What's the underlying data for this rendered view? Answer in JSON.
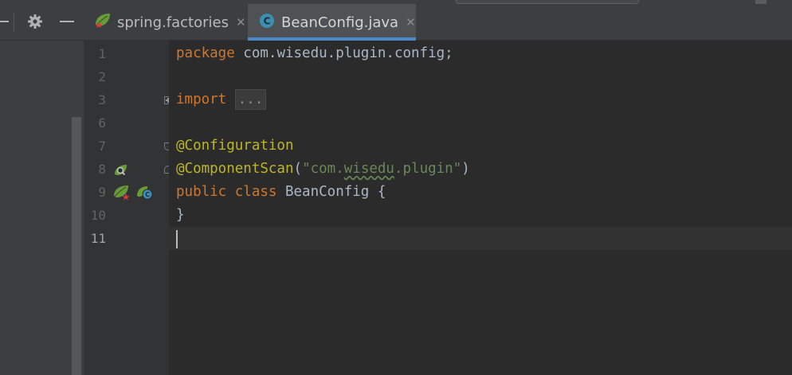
{
  "tabs": [
    {
      "label": "spring.factories",
      "active": false,
      "icon": "spring-leaf-icon"
    },
    {
      "label": "BeanConfig.java",
      "active": true,
      "icon": "java-class-icon"
    }
  ],
  "toolbar": {
    "settings_icon": "gear-icon",
    "hide_icon": "minimize-icon"
  },
  "gutter": {
    "line_numbers": [
      "1",
      "2",
      "3",
      "6",
      "7",
      "8",
      "9",
      "10",
      "11"
    ],
    "current_line": "11"
  },
  "code": {
    "line1": {
      "kw": "package",
      "rest": " com.wisedu.plugin.config;"
    },
    "line3": {
      "kw": "import",
      "folded": "..."
    },
    "line7": {
      "annotation": "@Configuration"
    },
    "line8": {
      "annotation": "@ComponentScan",
      "open": "(",
      "str_open": "\"com.",
      "str_squiggle": "wisedu",
      "str_close": ".plugin\"",
      "close": ")"
    },
    "line9": {
      "kw1": "public",
      "kw2": "class",
      "name": " BeanConfig {"
    },
    "line10": {
      "text": "}"
    }
  },
  "colors": {
    "keyword": "#cc7832",
    "annotation": "#bbb529",
    "string": "#6a8759",
    "text": "#a9b7c6",
    "tab_underline": "#4a88c7"
  }
}
